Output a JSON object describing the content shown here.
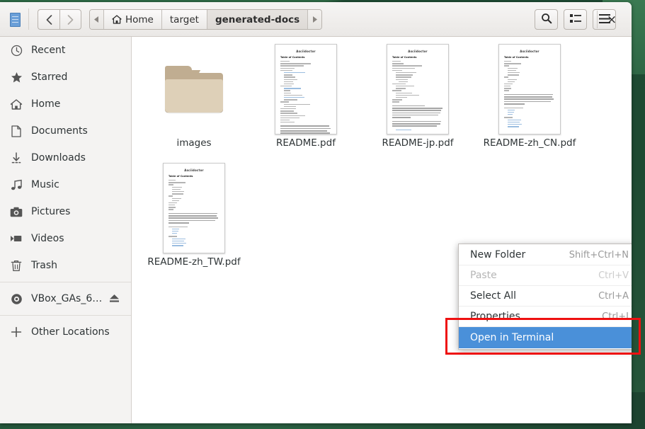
{
  "desktop": {
    "bg_color": "#215238",
    "bg_color_light": "#3b7a52"
  },
  "window": {
    "app_icon": "file-manager-icon",
    "nav": {
      "back_label": "‹",
      "forward_label": "›"
    },
    "breadcrumb": {
      "prev_arrow": "◀",
      "next_arrow": "▶",
      "items": [
        {
          "label": "Home",
          "icon": "home-icon",
          "active": false
        },
        {
          "label": "target",
          "icon": "",
          "active": false
        },
        {
          "label": "generated-docs",
          "icon": "",
          "active": true
        }
      ]
    },
    "toolbar": {
      "search_label": "search-icon",
      "view_list_label": "list-view-icon",
      "menu_label": "hamburger-menu-icon",
      "close_label": "×"
    }
  },
  "sidebar": {
    "items": [
      {
        "label": "Recent",
        "icon": "clock-icon"
      },
      {
        "label": "Starred",
        "icon": "star-icon"
      },
      {
        "label": "Home",
        "icon": "home-icon"
      },
      {
        "label": "Documents",
        "icon": "document-icon"
      },
      {
        "label": "Downloads",
        "icon": "download-icon"
      },
      {
        "label": "Music",
        "icon": "music-icon"
      },
      {
        "label": "Pictures",
        "icon": "camera-icon"
      },
      {
        "label": "Videos",
        "icon": "video-icon"
      },
      {
        "label": "Trash",
        "icon": "trash-icon"
      }
    ],
    "devices": [
      {
        "label": "VBox_GAs_6…",
        "icon": "disc-icon",
        "eject": "eject-icon"
      }
    ],
    "other": {
      "label": "Other Locations",
      "icon": "plus-icon"
    }
  },
  "files": [
    {
      "name": "images",
      "type": "folder",
      "doc_title": "",
      "doc_toc": ""
    },
    {
      "name": "README.pdf",
      "type": "pdf",
      "doc_title": "Asciidoctor",
      "doc_toc": "Table of Contents"
    },
    {
      "name": "README-jp.pdf",
      "type": "pdf",
      "doc_title": "Asciidoctor",
      "doc_toc": "Table of Contents"
    },
    {
      "name": "README-zh_CN.pdf",
      "type": "pdf",
      "doc_title": "Asciidoctor",
      "doc_toc": "Table of Contents"
    },
    {
      "name": "README-zh_TW.pdf",
      "type": "pdf",
      "doc_title": "Asciidoctor",
      "doc_toc": "Table of Contents"
    }
  ],
  "context_menu": {
    "items": [
      {
        "label": "New Folder",
        "accel": "Shift+Ctrl+N",
        "state": "normal"
      },
      {
        "label": "Paste",
        "accel": "Ctrl+V",
        "state": "disabled"
      },
      {
        "label": "Select All",
        "accel": "Ctrl+A",
        "state": "normal"
      },
      {
        "label": "Properties",
        "accel": "Ctrl+I",
        "state": "normal"
      },
      {
        "label": "Open in Terminal",
        "accel": "",
        "state": "selected"
      }
    ],
    "highlight_color": "#ee1111",
    "selected_color": "#4a90d9"
  }
}
